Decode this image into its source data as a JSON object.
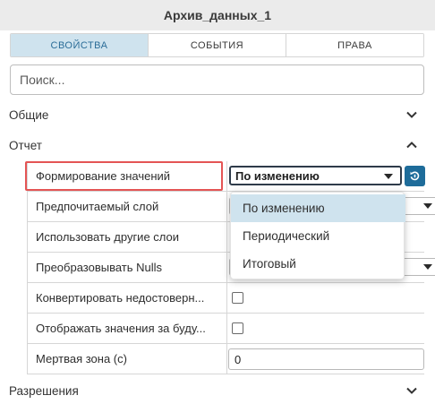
{
  "window": {
    "title": "Архив_данных_1"
  },
  "tabs": [
    {
      "label": "СВОЙСТВА",
      "active": true
    },
    {
      "label": "СОБЫТИЯ",
      "active": false
    },
    {
      "label": "ПРАВА",
      "active": false
    }
  ],
  "search": {
    "placeholder": "Поиск..."
  },
  "sections": {
    "general": {
      "label": "Общие",
      "expanded": false
    },
    "report": {
      "label": "Отчет",
      "expanded": true
    },
    "permissions": {
      "label": "Разрешения",
      "expanded": false
    }
  },
  "properties": [
    {
      "label": "Формирование значений",
      "type": "select",
      "value": "По изменению"
    },
    {
      "label": "Предпочитаемый слой",
      "type": "select",
      "value": ""
    },
    {
      "label": "Использовать другие слои",
      "type": "text",
      "value": ""
    },
    {
      "label": "Преобразовывать Nulls",
      "type": "select",
      "value": ""
    },
    {
      "label": "Конвертировать недостоверн...",
      "type": "checkbox",
      "checked": false
    },
    {
      "label": "Отображать значения за буду...",
      "type": "checkbox",
      "checked": false
    },
    {
      "label": "Мертвая зона (с)",
      "type": "number",
      "value": "0"
    }
  ],
  "dropdown": {
    "options": [
      "По изменению",
      "Периодический",
      "Итоговый"
    ],
    "selected": "По изменению"
  },
  "colors": {
    "accent": "#1e6c9a",
    "tab_active_bg": "#cfe3ee",
    "highlight_border": "#e45454"
  }
}
